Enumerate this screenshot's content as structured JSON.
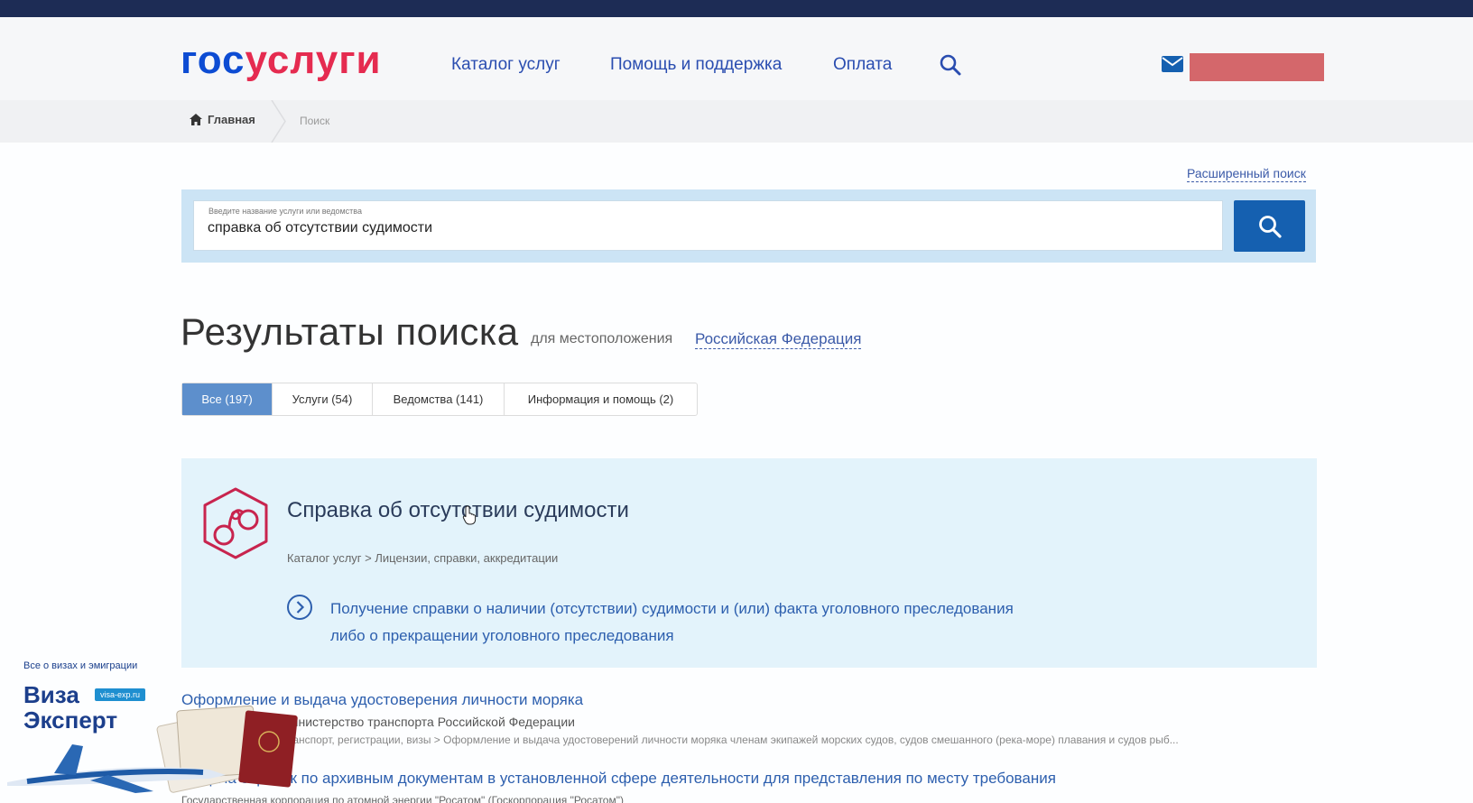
{
  "header": {
    "logo_part1": "гос",
    "logo_part2": "услуги",
    "nav": [
      {
        "label": "Каталог услуг"
      },
      {
        "label": "Помощь и поддержка"
      },
      {
        "label": "Оплата"
      }
    ],
    "brand_color": "#0d4cd3",
    "accent_color": "#e52b50"
  },
  "breadcrumb": {
    "home": "Главная",
    "current": "Поиск"
  },
  "search": {
    "advanced_link": "Расширенный поиск",
    "placeholder": "Введите название услуги или ведомства",
    "value": "справка об отсутствии судимости"
  },
  "results": {
    "title": "Результаты поиска",
    "location_label": "для местоположения",
    "region": "Российская Федерация",
    "tabs": [
      {
        "label": "Все (197)",
        "active": true
      },
      {
        "label": "Услуги (54)",
        "active": false
      },
      {
        "label": "Ведомства (141)",
        "active": false
      },
      {
        "label": "Информация и помощь (2)",
        "active": false
      }
    ],
    "featured": {
      "title": "Справка об отсутствии судимости",
      "crumbs": "Каталог услуг > Лицензии, справки, аккредитации",
      "description": "Получение справки о наличии (отсутствии) судимости и (или) факта уголовного преследования либо о прекращении уголовного преследования"
    },
    "items": [
      {
        "title": "Оформление и выдача удостоверения личности моряка",
        "dept": "Министерство транспорта Российской Федерации",
        "path": "Транспорт, регистрации, визы > Оформление и выдача удостоверений личности моряка членам экипажей морских судов, судов смешанного (река-море) плавания и судов рыб..."
      },
      {
        "title": "Выдача справок по архивным документам в установленной сфере деятельности для представления по месту требования",
        "dept": "Государственная корпорация по атомной энергии \"Росатом\" (Госкорпорация \"Росатом\")"
      }
    ]
  },
  "watermark": {
    "tagline": "Все о визах и эмиграции",
    "name1": "Виза",
    "name2": "Эксперт",
    "site": "visa-exp.ru"
  }
}
